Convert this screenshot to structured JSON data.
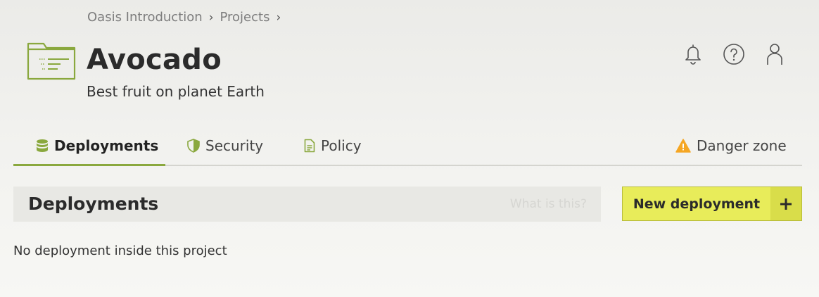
{
  "breadcrumb": {
    "items": [
      "Oasis Introduction",
      "Projects"
    ],
    "separator": "›"
  },
  "project": {
    "title": "Avocado",
    "description": "Best fruit on planet Earth",
    "icon": "folder-icon"
  },
  "header_icons": [
    "bell-icon",
    "help-icon",
    "user-icon"
  ],
  "tabs": [
    {
      "label": "Deployments",
      "icon": "database-icon",
      "active": true
    },
    {
      "label": "Security",
      "icon": "shield-icon",
      "active": false
    },
    {
      "label": "Policy",
      "icon": "document-icon",
      "active": false
    },
    {
      "label": "Danger zone",
      "icon": "warning-icon",
      "active": false
    }
  ],
  "section": {
    "title": "Deployments",
    "help_link": "What is this?"
  },
  "new_deployment": {
    "label": "New deployment",
    "icon": "plus-icon"
  },
  "empty_message": "No deployment inside this project",
  "colors": {
    "accent": "#8aa83e",
    "button": "#e8ec5a",
    "warning": "#f5a623"
  }
}
